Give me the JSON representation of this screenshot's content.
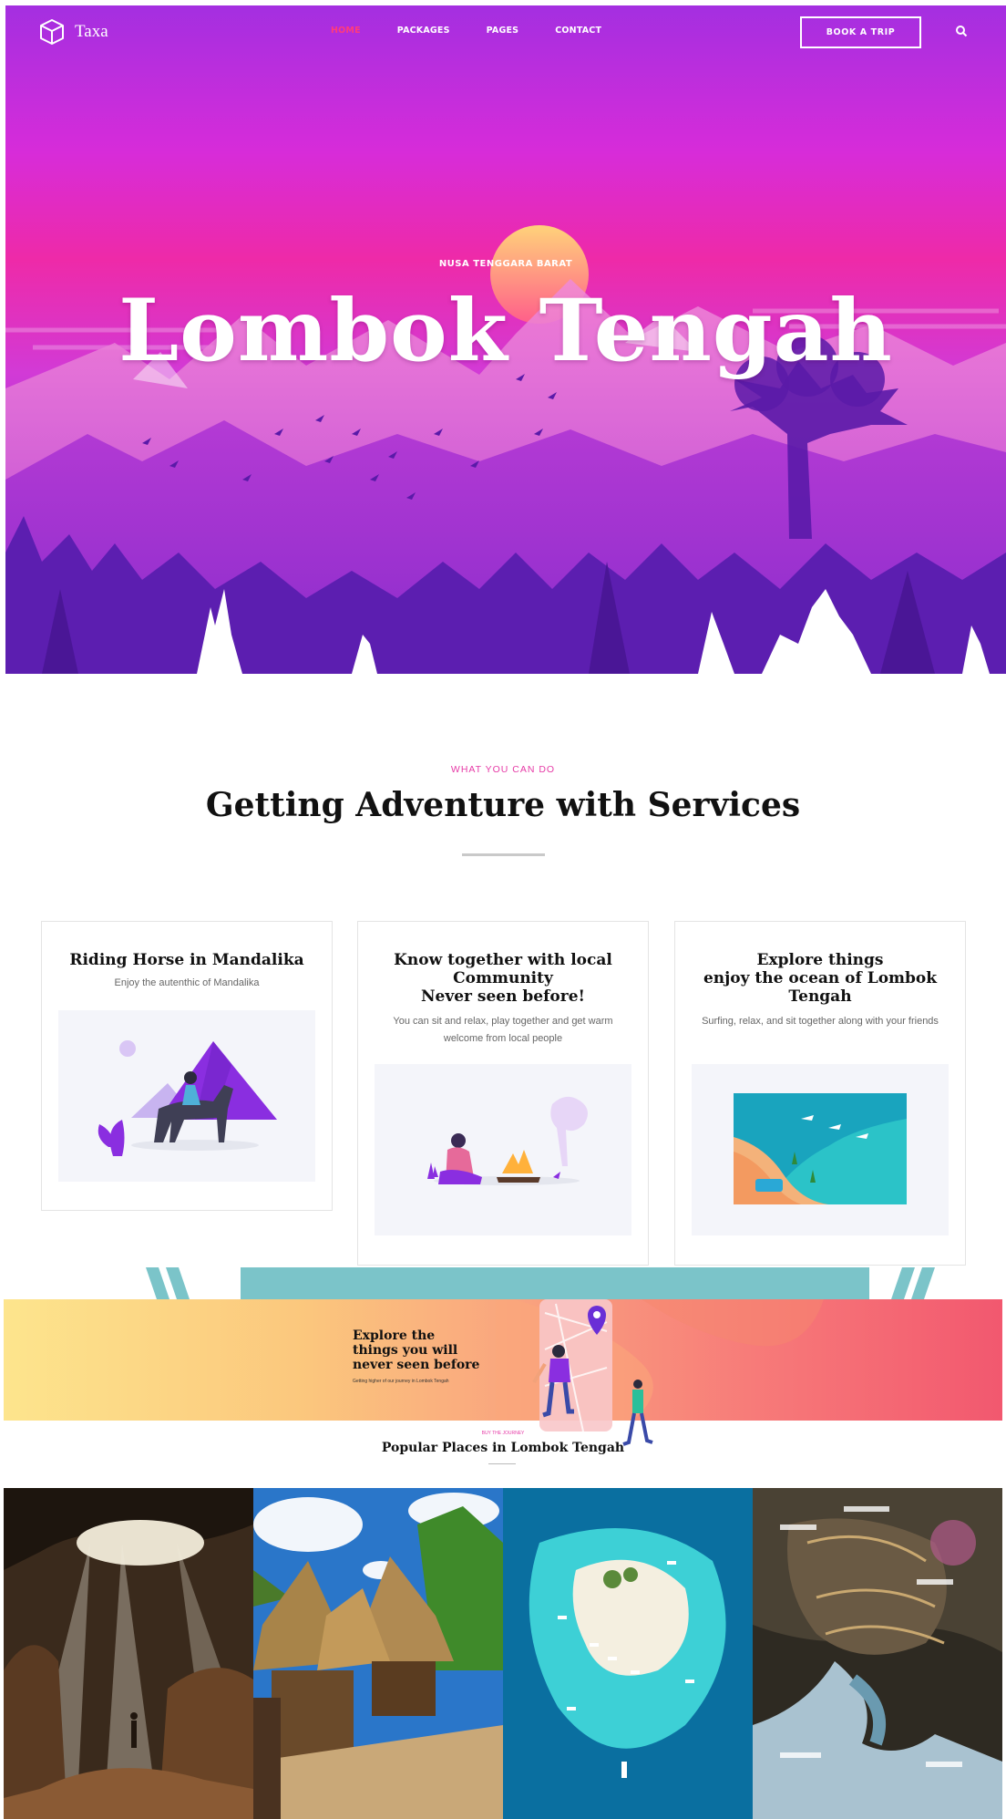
{
  "header": {
    "brand": "Taxa",
    "nav": [
      {
        "label": "HOME",
        "active": true
      },
      {
        "label": "PACKAGES",
        "active": false
      },
      {
        "label": "PAGES",
        "active": false
      },
      {
        "label": "CONTACT",
        "active": false
      }
    ],
    "cta": "BOOK A TRIP"
  },
  "hero": {
    "kicker": "NUSA TENGGARA BARAT",
    "title": "Lombok Tengah"
  },
  "services": {
    "kicker": "WHAT YOU CAN DO",
    "title": "Getting Adventure with Services",
    "cards": [
      {
        "title": "Riding Horse in Mandalika",
        "text": "Enjoy the autenthic of Mandalika"
      },
      {
        "title": "Know together with local\nCommunity\nNever seen before!",
        "text": "You can sit and relax, play together and get warm welcome from local people"
      },
      {
        "title": "Explore things\nenjoy the ocean of Lombok\nTengah",
        "text": "Surfing, relax, and sit together along with your friends"
      }
    ]
  },
  "banner": {
    "title": "Explore the things you will never seen before",
    "subtitle": "Getting higher of our journey in Lombok Tengah"
  },
  "popular": {
    "kicker": "BUY THE JOURNEY",
    "title": "Popular Places in Lombok Tengah"
  },
  "colors": {
    "accent": "#ff3b7b",
    "hero_top": "#a42fe0",
    "hero_mid": "#ee2aa8",
    "hero_bottom": "#6a22b8"
  }
}
